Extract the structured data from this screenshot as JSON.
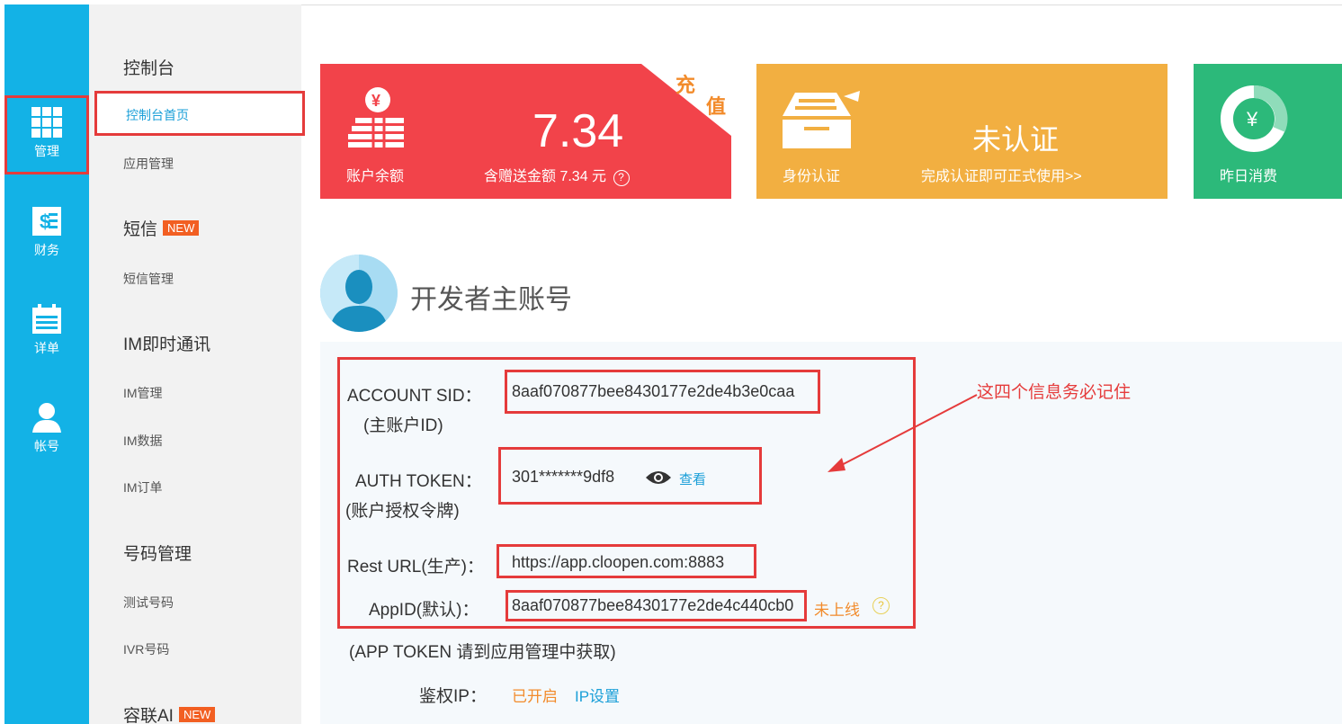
{
  "rail": {
    "items": [
      {
        "label": "管理",
        "icon": "grid-icon"
      },
      {
        "label": "财务",
        "icon": "finance-icon"
      },
      {
        "label": "详单",
        "icon": "calendar-icon"
      },
      {
        "label": "帐号",
        "icon": "user-icon"
      }
    ]
  },
  "submenu": {
    "console_header": "控制台",
    "console_home": "控制台首页",
    "app_manage": "应用管理",
    "sms_header": "短信",
    "sms_badge": "NEW",
    "sms_manage": "短信管理",
    "im_header": "IM即时通讯",
    "im_manage": "IM管理",
    "im_data": "IM数据",
    "im_orders": "IM订单",
    "number_header": "号码管理",
    "test_numbers": "测试号码",
    "ivr_numbers": "IVR号码",
    "ai_header": "容联AI",
    "ai_badge": "NEW"
  },
  "cards": {
    "balance": {
      "label": "账户余额",
      "amount": "7.34",
      "bonus_text": "含赠送金额 7.34 元",
      "corner_1": "充",
      "corner_2": "值",
      "color": "#f2434a"
    },
    "identity": {
      "label": "身份认证",
      "status": "未认证",
      "hint": "完成认证即可正式使用>>",
      "color": "#f2af41"
    },
    "consumption": {
      "label": "昨日消费",
      "color": "#2cb97a"
    }
  },
  "developer": {
    "title": "开发者主账号",
    "account_sid_label": "ACCOUNT SID：",
    "account_sid_sub": "(主账户ID)",
    "account_sid_value": "8aaf070877bee8430177e2de4b3e0caa",
    "auth_token_label": "AUTH TOKEN：",
    "auth_token_sub": "(账户授权令牌)",
    "auth_token_value": "301*******9df8",
    "view_label": "查看",
    "rest_url_label": "Rest URL(生产)：",
    "rest_url_value": "https://app.cloopen.com:8883",
    "appid_label": "AppID(默认)：",
    "appid_value": "8aaf070877bee8430177e2de4c440cb0",
    "appid_status": "未上线",
    "app_token_note": "(APP TOKEN 请到应用管理中获取)",
    "auth_ip_label": "鉴权IP：",
    "auth_ip_status": "已开启",
    "ip_settings": "IP设置"
  },
  "annotation": {
    "note": "这四个信息务必记住"
  }
}
